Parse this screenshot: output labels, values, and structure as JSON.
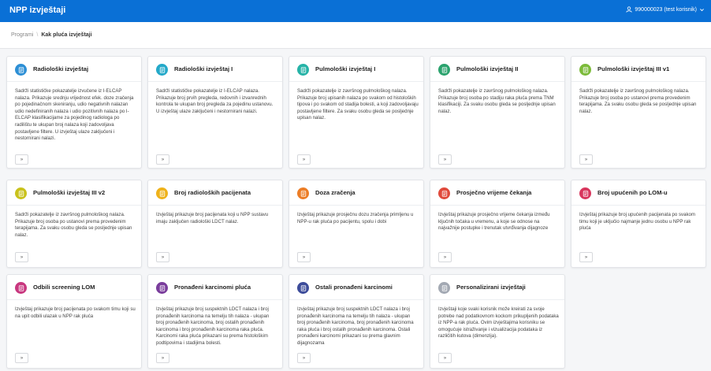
{
  "header": {
    "app_title": "NPP izvještaji",
    "user_label": "990000023 (test korisnik)"
  },
  "breadcrumb": {
    "root": "Programi",
    "separator": "\\",
    "current": "Kak pluća izvještaji"
  },
  "cards": [
    {
      "title": "Radiološki izvještaj",
      "icon": "report-icon",
      "color": "#2d8fd5",
      "button": "»",
      "description": "Sadrži statističke pokazatelje izvučene iz I-ELCAP nalaza. Prikazuje srednju vrijednost efek. doze zračenja po pojedinačnom skeniranju, udio negativnih nalazan udio nedefiniranih nalaza i udio pozitivnih nalaza po I-ELCAP klasifikacijame za pojedinog radiologa po radilištu te ukupan broj nalaza koji zadovoljava postavljene filtere. U izvještaj ulaze zaključeni i nestornirani nalazi."
    },
    {
      "title": "Radiološki izvještaj I",
      "icon": "report-icon",
      "color": "#24a9c9",
      "button": "»",
      "description": "Sadrži statističke pokazatelje iz I-ELCAP nalaza. Prikazuje broj prvih pregleda, redovnih i izvanrednih kontrola te ukupan broj pregleda za pojedinu ustanovu. U izvještaj ulaze zaključeni i nestornirani nalazi."
    },
    {
      "title": "Pulmološki izvještaj I",
      "icon": "report-icon",
      "color": "#26b3a7",
      "button": "»",
      "description": "Sadrži pokazatelje iz završnog pulmološkog nalaza. Prikazuje broj upisanih nalaza po svakom od histoloških tipova i po svakom od stadija bolesti, a koji zadovoljavaju postavljene filtere. Za svaku osobu gleda se posljednje upisan nalaz."
    },
    {
      "title": "Pulmološki izvještaj II",
      "icon": "report-icon",
      "color": "#2ba36e",
      "button": "»",
      "description": "Sadrži pokazatelje iz završnog pulmološkog nalaza. Prikazuje broj osoba po stadiju raka pluća prema TNM klasifikaciji. Za svaku osobu gleda se posljednje upisan nalaz."
    },
    {
      "title": "Pulmološki izvještaj III v1",
      "icon": "report-icon",
      "color": "#7cbb3a",
      "button": "»",
      "description": "Sadrži pokazatelje iz završnog pulmološkog nalaza. Prikazuje broj osoba po ustanovi prema provedenim terapijama. Za svaku osobu gleda se posljednje upisan nalaz."
    },
    {
      "title": "Pulmološki izvještaj III v2",
      "icon": "report-icon",
      "color": "#c9c21c",
      "button": "»",
      "description": "Sadrži pokazatelje iz završnog pulmološkog nalaza. Prikazuje broj osoba po ustanovi prema provedenim terapijama. Za svaku osobu gleda se posljednje upisan nalaz."
    },
    {
      "title": "Broj radioloških pacijenata",
      "icon": "report-icon",
      "color": "#efb21a",
      "button": "»",
      "description": "Izvještaj prikazuje broj pacijenata koji u NPP sustavu imaju zaključen radiološki LDCT nalaz."
    },
    {
      "title": "Doza zračenja",
      "icon": "report-icon",
      "color": "#ec7d26",
      "button": "»",
      "description": "Izvještaj prikazuje prosječnu dozu zračenja primljenu u NPP-u rak pluća po pacijentu, spolu i dobi"
    },
    {
      "title": "Prosječno vrijeme čekanja",
      "icon": "report-icon",
      "color": "#e04a3c",
      "button": "»",
      "description": "Izvještaj prikazuje prosječno vrijeme čekanja između ključnih točaka u vremenu, a koje se odnose na najvažnije postupke i trenutak utvrđivanja dijagnoze"
    },
    {
      "title": "Broj upućenih po LOM-u",
      "icon": "report-icon",
      "color": "#d8365d",
      "button": "»",
      "description": "Izvještaj prikazuje broj upućenih pacijenata po svakom timu koji je uključio najmanje jednu osobu u NPP rak pluća"
    },
    {
      "title": "Odbili screening LOM",
      "icon": "report-icon",
      "color": "#c8377f",
      "button": "»",
      "description": "Izvještaj prikazuje broj pacijenata po svakom timu koji su na upit odbili ulazak u NPP rak pluća"
    },
    {
      "title": "Pronađeni karcinomi pluća",
      "icon": "report-icon",
      "color": "#7a3d9c",
      "button": "»",
      "description": "Izvještaj prikazuje broj suspektnih LDCT nalaza i broj pronađenih karcinoma na temelju tih nalaza - ukupan broj pronađenih karcinoma, broj ostalih pronađenih karcinoma i broj pronađenih karcinoma raka pluća. Karcinomi raka pluća prikazani su prema histološkim podtipovima i stadijima bolesti."
    },
    {
      "title": "Ostali pronađeni karcinomi",
      "icon": "report-icon",
      "color": "#3d4c9a",
      "button": "»",
      "description": "Izvještaj prikazuje broj suspektnih LDCT nalaza i broj pronađenih karcinoma na temelju tih nalaza - ukupan broj pronađenih karcinoma, broj pronađenih karcinoma raka pluća i broj ostalih pronađenih karcinoma. Ostali pronađeni karcinomi prikazani su prema glavnim dijagnozama"
    },
    {
      "title": "Personalizirani izvještaji",
      "icon": "report-icon",
      "color": "#a3a9b3",
      "button": "»",
      "description": "Izvještaji koje svaki korisnik može kreirati za svoje potrebe nad podatkovnom kockom prikupljenih podataka iz NPP-a rak pluća. Ovim izvještajima korisniku se omogućuje istraživanje i vizualizacija podataka iz različitih kutova (dimenzija)."
    }
  ]
}
